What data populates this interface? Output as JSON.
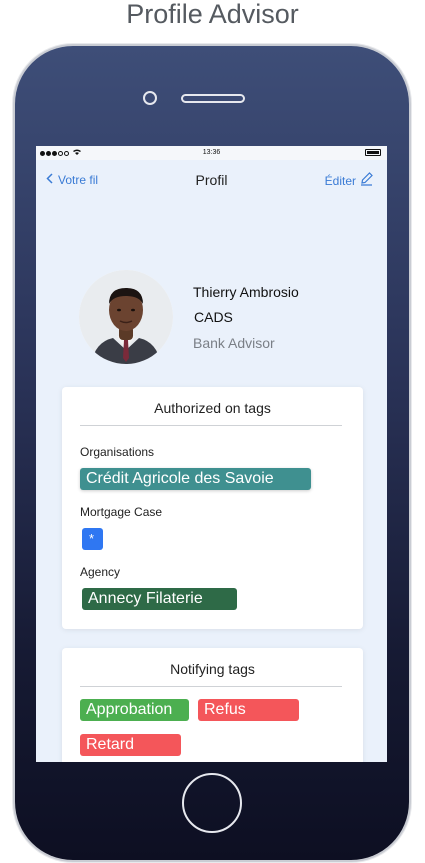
{
  "page": {
    "title": "Profile Advisor"
  },
  "status_bar": {
    "time": "13:36",
    "wifi_icon": "wifi-icon"
  },
  "nav": {
    "back_label": "Votre fil",
    "title": "Profil",
    "edit_label": "Éditer"
  },
  "profile": {
    "name": "Thierry Ambrosio",
    "company": "CADS",
    "role": "Bank Advisor"
  },
  "authorized": {
    "title": "Authorized on tags",
    "organisations_label": "Organisations",
    "organisation_tag": "Crédit Agricole des Savoie",
    "mortgage_label": "Mortgage Case",
    "mortgage_tag": "*",
    "agency_label": "Agency",
    "agency_tag": "Annecy Filaterie"
  },
  "notifying": {
    "title": "Notifying tags",
    "tags": [
      "Approbation",
      "Refus",
      "Retard"
    ]
  },
  "colors": {
    "accent": "#3a7bd5",
    "teal": "#3f9090",
    "blue": "#2f77f2",
    "dark_green": "#2e6a47",
    "green": "#4caf50",
    "red": "#f4565a"
  }
}
